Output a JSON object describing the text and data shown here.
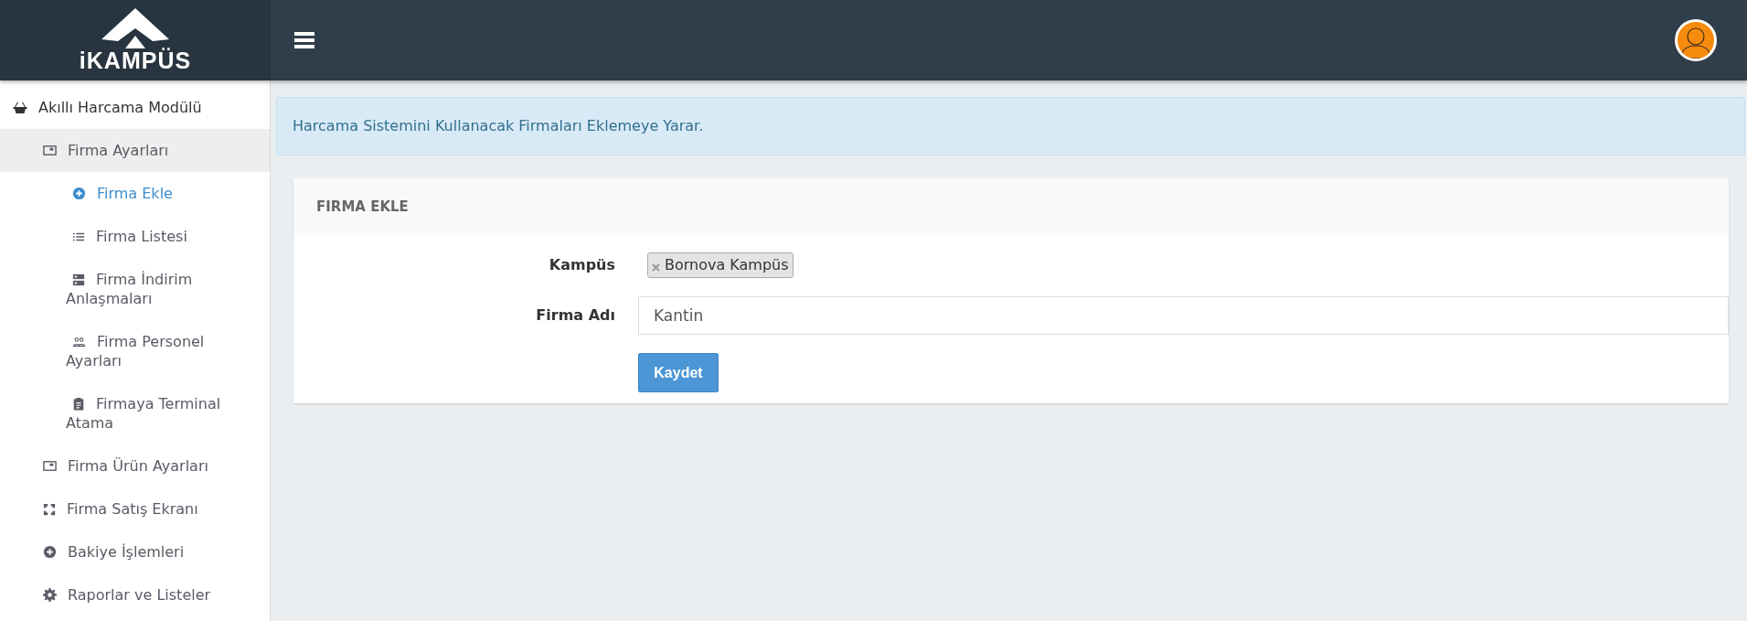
{
  "header": {
    "logo_text": "iKAMPÜS"
  },
  "sidebar": {
    "items": [
      {
        "label": "Akıllı Harcama Modülü",
        "children": [
          {
            "label": "Firma Ayarları",
            "expanded": true,
            "children": [
              {
                "label": "Firma Ekle",
                "selected": true
              },
              {
                "label": "Firma Listesi",
                "selected": false
              },
              {
                "label": "Firma İndirim Anlaşmaları",
                "selected": false
              },
              {
                "label": "Firma Personel Ayarları",
                "selected": false
              },
              {
                "label": "Firmaya Terminal Atama",
                "selected": false
              }
            ]
          },
          {
            "label": "Firma Ürün Ayarları",
            "expanded": false
          },
          {
            "label": "Firma Satış Ekranı",
            "expanded": false
          },
          {
            "label": "Bakiye İşlemleri",
            "expanded": false
          },
          {
            "label": "Raporlar ve Listeler",
            "expanded": false
          }
        ]
      }
    ]
  },
  "alert": {
    "text": "Harcama Sistemini Kullanacak Firmaları Eklemeye Yarar."
  },
  "panel": {
    "title": "FIRMA EKLE",
    "fields": [
      {
        "kind": "tags",
        "label": "Kampüs",
        "tags": [
          "Bornova Kampüs"
        ]
      },
      {
        "kind": "text",
        "label": "Firma Adı",
        "value": "Kantin"
      }
    ],
    "button": "Kaydet"
  }
}
